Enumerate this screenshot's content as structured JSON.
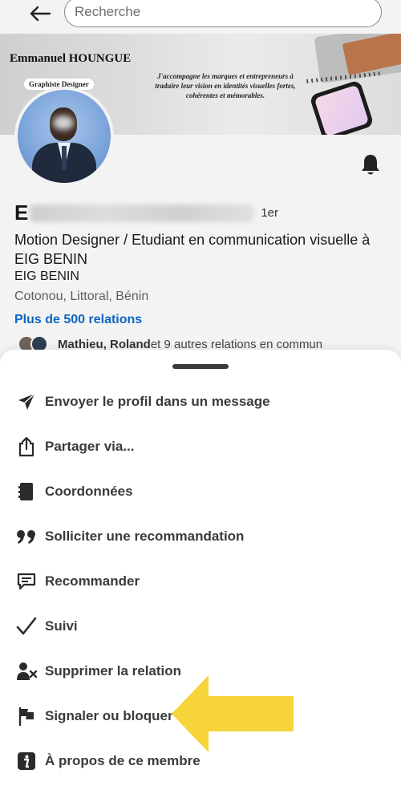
{
  "search": {
    "placeholder": "Recherche"
  },
  "banner": {
    "name": "Emmanuel HOUNGUE",
    "tag": "Graphiste Designer",
    "quote": "J'accompagne les marques et entrepreneurs à traduire leur vision en identités visuelles fortes, cohérentes et mémorables."
  },
  "profile": {
    "name_initial": "E",
    "degree": "1er",
    "headline": "Motion Designer / Etudiant en communication visuelle à EIG BENIN",
    "company": "EIG BENIN",
    "location": "Cotonou, Littoral, Bénin",
    "connections": "Plus de 500 relations",
    "mutual_names": "Mathieu, Roland",
    "mutual_suffix": " et 9 autres relations en commun"
  },
  "menu": {
    "items": [
      {
        "label": "Envoyer le profil dans un message",
        "icon": "send-icon"
      },
      {
        "label": "Partager via...",
        "icon": "share-icon"
      },
      {
        "label": "Coordonnées",
        "icon": "contact-card-icon"
      },
      {
        "label": "Solliciter une recommandation",
        "icon": "quote-icon"
      },
      {
        "label": "Recommander",
        "icon": "comment-icon"
      },
      {
        "label": "Suivi",
        "icon": "checkmark-icon"
      },
      {
        "label": "Supprimer la relation",
        "icon": "remove-person-icon"
      },
      {
        "label": "Signaler ou bloquer",
        "icon": "flag-icon"
      },
      {
        "label": "À propos de ce membre",
        "icon": "info-icon"
      }
    ]
  },
  "colors": {
    "link": "#0a66c2",
    "arrow": "#f7d43a"
  }
}
